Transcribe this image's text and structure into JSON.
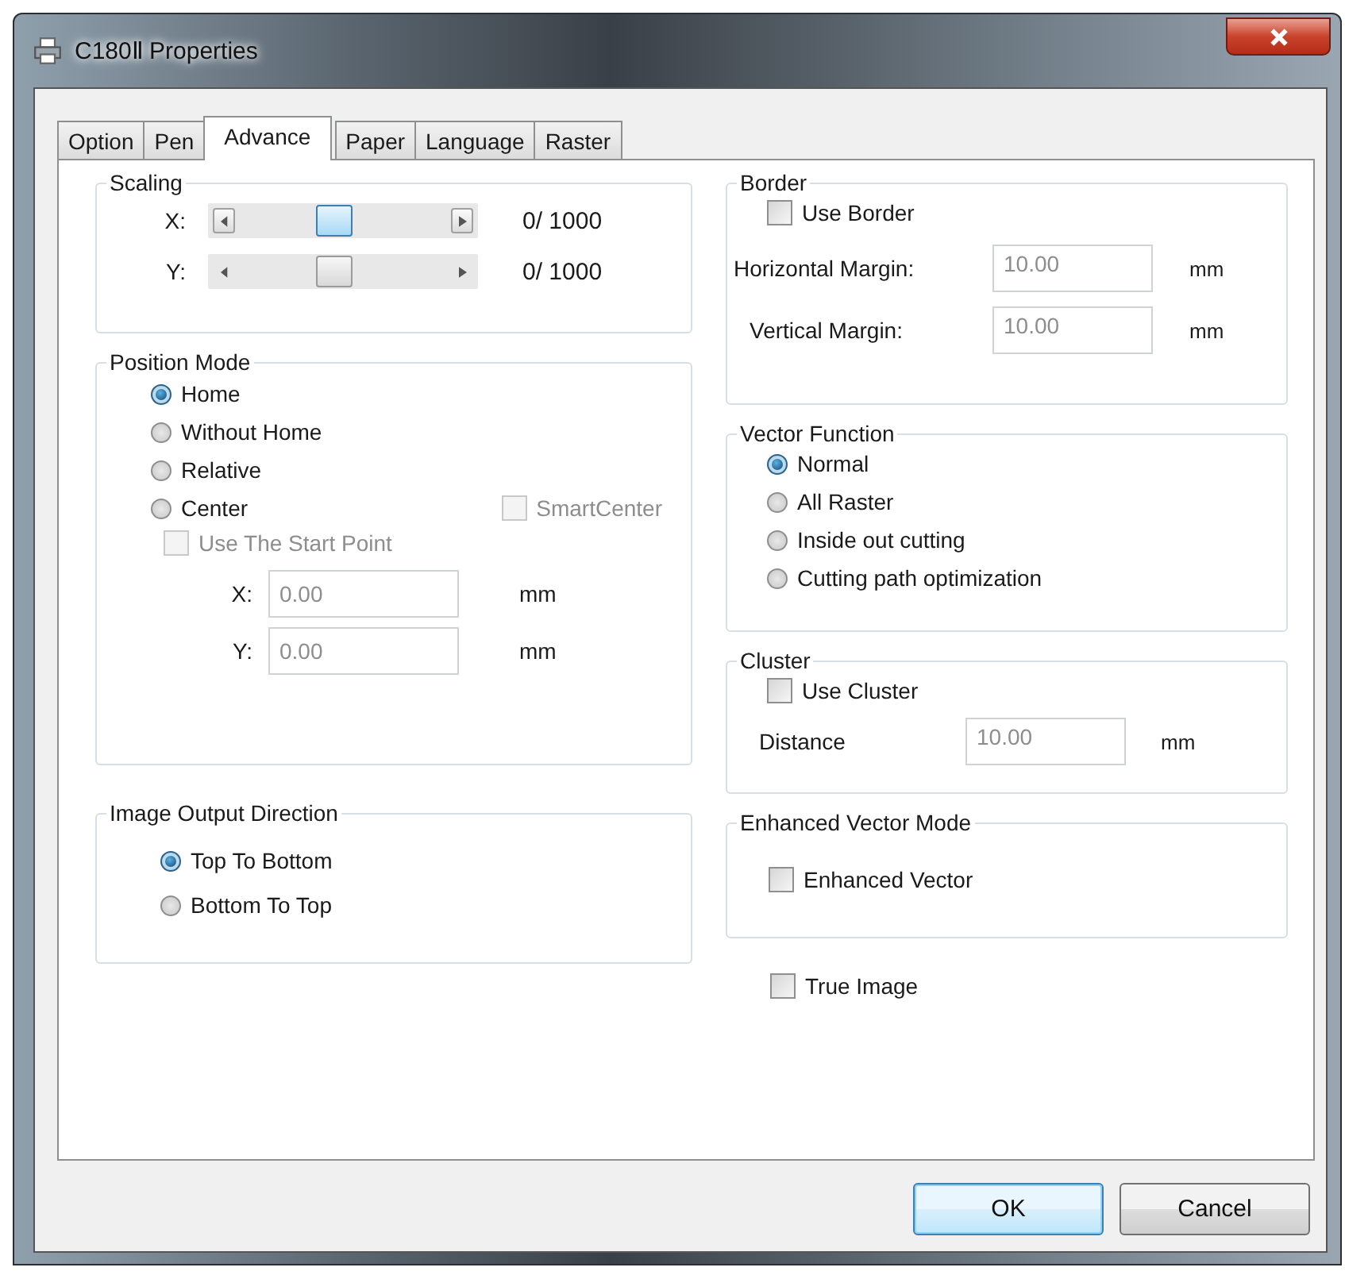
{
  "window": {
    "title": "C180Ⅱ Properties"
  },
  "tabs": [
    {
      "label": "Option",
      "selected": false
    },
    {
      "label": "Pen",
      "selected": false
    },
    {
      "label": "Advance",
      "selected": true
    },
    {
      "label": "Paper",
      "selected": false
    },
    {
      "label": "Language",
      "selected": false
    },
    {
      "label": "Raster",
      "selected": false
    }
  ],
  "scaling": {
    "title": "Scaling",
    "rows": [
      {
        "label": "X:",
        "level": 0.45,
        "reading": "0/ 1000",
        "active": true
      },
      {
        "label": "Y:",
        "level": 0.45,
        "reading": "0/ 1000",
        "active": false
      }
    ]
  },
  "position_mode": {
    "title": "Position Mode",
    "options": [
      {
        "label": "Home",
        "selected": true
      },
      {
        "label": "Without Home",
        "selected": false
      },
      {
        "label": "Relative",
        "selected": false
      },
      {
        "label": "Center",
        "selected": false
      }
    ],
    "smart_center": {
      "label": "SmartCenter",
      "checked": false,
      "disabled": true
    },
    "use_start_point": {
      "label": "Use The Start Point",
      "checked": false,
      "disabled": true
    },
    "fields": [
      {
        "label": "X:",
        "value": "0.00",
        "unit": "mm",
        "disabled": true
      },
      {
        "label": "Y:",
        "value": "0.00",
        "unit": "mm",
        "disabled": true
      }
    ]
  },
  "image_output_direction": {
    "title": "Image Output Direction",
    "options": [
      {
        "label": "Top To Bottom",
        "selected": true
      },
      {
        "label": "Bottom To Top",
        "selected": false
      }
    ]
  },
  "border": {
    "title": "Border",
    "use_border": {
      "label": "Use Border",
      "checked": false,
      "disabled": false
    },
    "fields": [
      {
        "label": "Horizontal Margin:",
        "value": "10.00",
        "unit": "mm",
        "disabled": true
      },
      {
        "label": "Vertical Margin:",
        "value": "10.00",
        "unit": "mm",
        "disabled": true
      }
    ]
  },
  "vector_function": {
    "title": "Vector Function",
    "options": [
      {
        "label": "Normal",
        "selected": true
      },
      {
        "label": "All Raster",
        "selected": false
      },
      {
        "label": "Inside out cutting",
        "selected": false
      },
      {
        "label": "Cutting path optimization",
        "selected": false
      }
    ]
  },
  "cluster": {
    "title": "Cluster",
    "use_cluster": {
      "label": "Use Cluster",
      "checked": false,
      "disabled": false
    },
    "fields": [
      {
        "label": "Distance",
        "value": "10.00",
        "unit": "mm",
        "disabled": true
      }
    ]
  },
  "enhanced_vector_mode": {
    "title": "Enhanced Vector Mode",
    "checkbox": {
      "label": "Enhanced Vector",
      "checked": false,
      "disabled": false
    }
  },
  "true_image": {
    "label": "True Image",
    "checked": false,
    "disabled": false
  },
  "buttons": [
    {
      "label": "OK",
      "default": true
    },
    {
      "label": "Cancel",
      "default": false
    }
  ]
}
